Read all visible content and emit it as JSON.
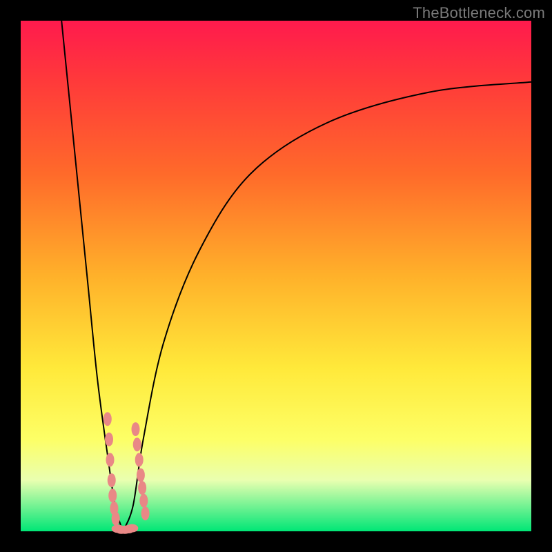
{
  "watermark": "TheBottleneck.com",
  "colors": {
    "background": "#000000",
    "gradient_top": "#ff1a4d",
    "gradient_bottom": "#00e676",
    "marker": "#e98886",
    "curve": "#000000"
  },
  "chart_data": {
    "type": "line",
    "title": "",
    "xlabel": "",
    "ylabel": "",
    "xlim": [
      0,
      100
    ],
    "ylim": [
      0,
      100
    ],
    "grid": false,
    "legend": false,
    "curve": {
      "description": "V-shaped bottleneck curve; value = 0 at minimum x≈20, rises sharply toward both edges",
      "min_x": 20,
      "left_branch": [
        {
          "x": 8,
          "y": 100
        },
        {
          "x": 10,
          "y": 80
        },
        {
          "x": 13,
          "y": 50
        },
        {
          "x": 15,
          "y": 30
        },
        {
          "x": 17,
          "y": 15
        },
        {
          "x": 18.5,
          "y": 5
        },
        {
          "x": 20,
          "y": 0
        }
      ],
      "right_branch": [
        {
          "x": 20,
          "y": 0
        },
        {
          "x": 22,
          "y": 5
        },
        {
          "x": 24,
          "y": 18
        },
        {
          "x": 28,
          "y": 37
        },
        {
          "x": 35,
          "y": 55
        },
        {
          "x": 45,
          "y": 70
        },
        {
          "x": 60,
          "y": 80
        },
        {
          "x": 80,
          "y": 86
        },
        {
          "x": 100,
          "y": 88
        }
      ]
    },
    "markers_left": [
      {
        "x": 17.0,
        "y": 22
      },
      {
        "x": 17.3,
        "y": 18
      },
      {
        "x": 17.5,
        "y": 14
      },
      {
        "x": 17.8,
        "y": 10
      },
      {
        "x": 18.0,
        "y": 7
      },
      {
        "x": 18.3,
        "y": 4.5
      },
      {
        "x": 18.6,
        "y": 2.5
      }
    ],
    "markers_right": [
      {
        "x": 22.5,
        "y": 20
      },
      {
        "x": 22.8,
        "y": 17
      },
      {
        "x": 23.2,
        "y": 14
      },
      {
        "x": 23.5,
        "y": 11
      },
      {
        "x": 23.8,
        "y": 8.5
      },
      {
        "x": 24.1,
        "y": 6
      },
      {
        "x": 24.4,
        "y": 3.5
      }
    ],
    "markers_floor": [
      {
        "x": 19.0,
        "y": 0.5
      },
      {
        "x": 19.7,
        "y": 0.3
      },
      {
        "x": 20.4,
        "y": 0.3
      },
      {
        "x": 21.1,
        "y": 0.4
      },
      {
        "x": 21.8,
        "y": 0.6
      }
    ]
  }
}
